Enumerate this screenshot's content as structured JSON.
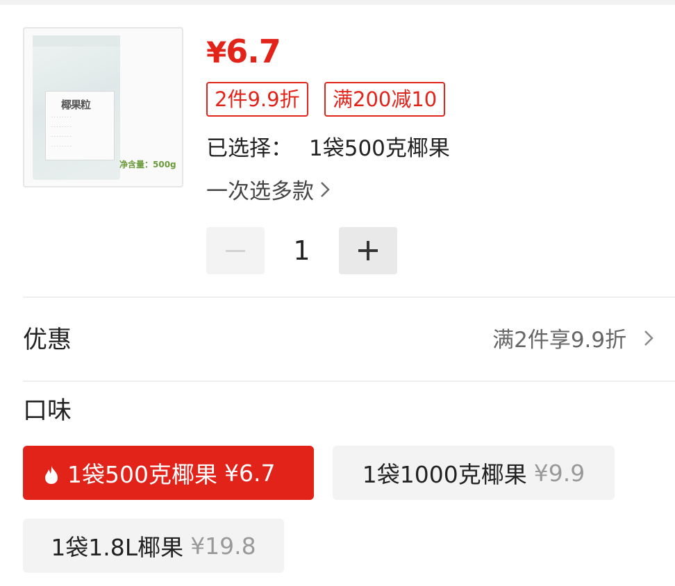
{
  "product": {
    "image_text": {
      "brand": "椰果粒",
      "net_weight": "净含量：500g"
    },
    "price_symbol": "¥",
    "price": "6.7",
    "tags": [
      "2件9.9折",
      "满200减10"
    ],
    "selected_label": "已选择：",
    "selected_value": "1袋500克椰果",
    "multi_select_label": "一次选多款",
    "quantity": "1"
  },
  "promo": {
    "title": "优惠",
    "value": "满2件享9.9折"
  },
  "flavor": {
    "title": "口味",
    "options": [
      {
        "name": "1袋500克椰果",
        "price": "¥6.7",
        "selected": true
      },
      {
        "name": "1袋1000克椰果",
        "price": "¥9.9",
        "selected": false
      },
      {
        "name": "1袋1.8L椰果",
        "price": "¥19.8",
        "selected": false
      }
    ]
  },
  "colors": {
    "accent": "#e2231a",
    "option_bg": "#f3f3f3"
  },
  "icons": [
    "flame-icon",
    "chevron-right-icon",
    "minus-icon",
    "plus-icon"
  ]
}
